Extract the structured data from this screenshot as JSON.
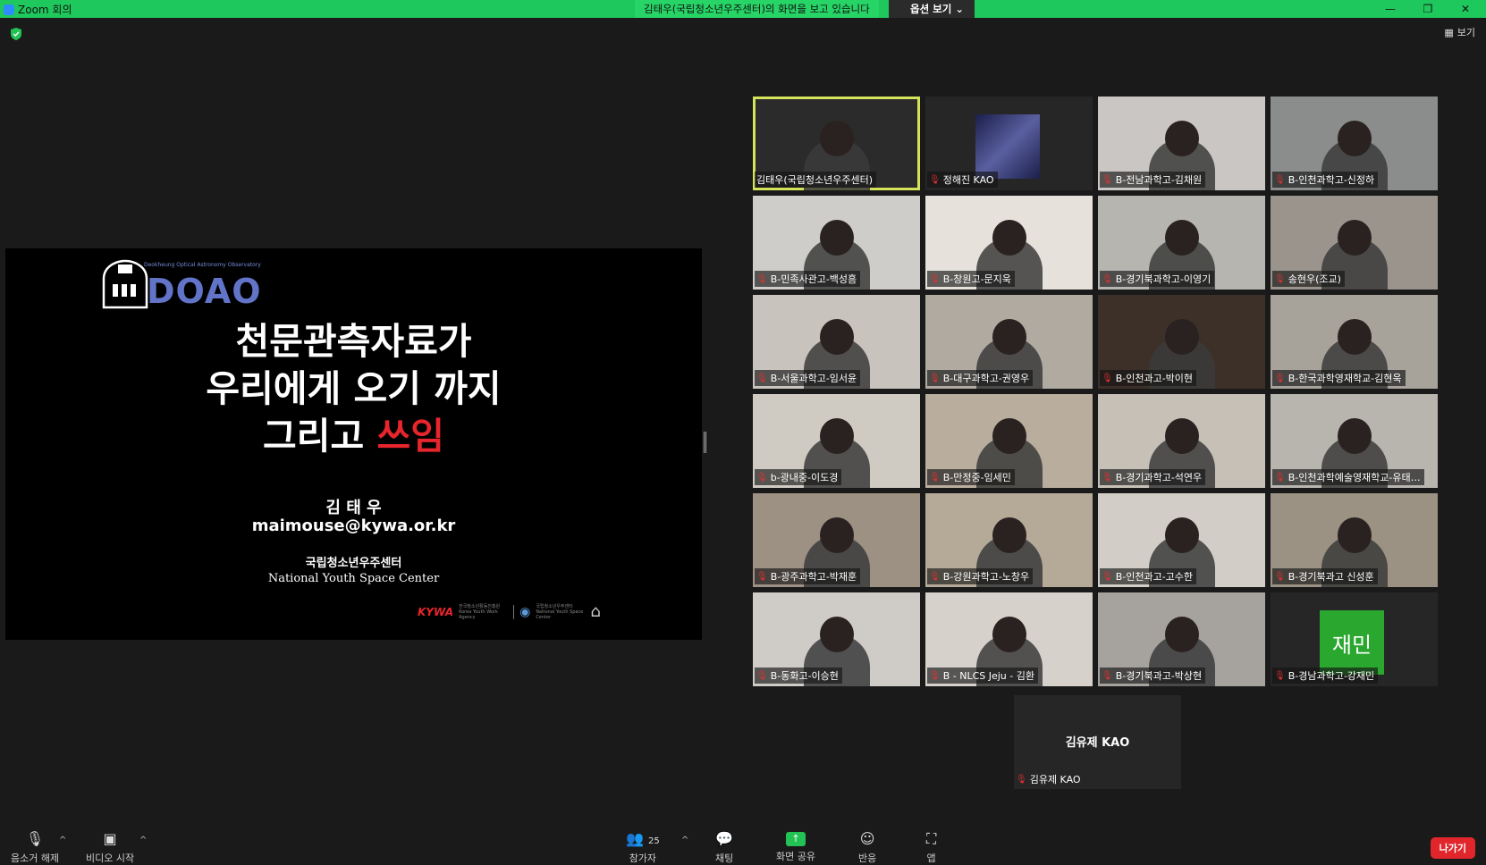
{
  "window": {
    "title": "Zoom 회의",
    "share_banner": "김태우(국립청소년우주센터)의 화면을 보고 있습니다",
    "view_options": "옵션 보기",
    "minimize": "—",
    "restore": "❐",
    "close": "✕"
  },
  "top_right": {
    "view_label": "보기"
  },
  "slide": {
    "logo_small_text": "Deokheung Optical Astronomy Observatory",
    "logo_text": "DOAO",
    "title_line1": "천문관측자료가",
    "title_line2": "우리에게 오기 까지",
    "title_line3_prefix": "그리고 ",
    "title_line3_highlight": "쓰임",
    "author": "김 태 우",
    "email": "maimouse@kywa.or.kr",
    "org_ko": "국립청소년우주센터",
    "org_en": "National Youth Space Center",
    "footer_kywa": "KYWA",
    "footer_kywa_sub": "한국청소년활동진흥원 Korea Youth Work Agency",
    "footer_center_sub": "국립청소년우주센터 National Youth Space Center"
  },
  "participants": [
    {
      "name": "김태우(국립청소년우주센터)",
      "muted": false,
      "active": true,
      "bg": "#2b2b2b"
    },
    {
      "name": "정해진 KAO",
      "muted": true,
      "active": false,
      "bg": "#262626"
    },
    {
      "name": "B-전남과학고-김채원",
      "muted": true,
      "active": false,
      "bg": "#c9c6c4"
    },
    {
      "name": "B-인천과학고-신정하",
      "muted": true,
      "active": false,
      "bg": "#8a8d8c"
    },
    {
      "name": "B-민족사관고-백성흠",
      "muted": true,
      "active": false,
      "bg": "#cfcdca"
    },
    {
      "name": "B-창원고-문지욱",
      "muted": true,
      "active": false,
      "bg": "#e6e1da"
    },
    {
      "name": "B-경기북과학고-이영기",
      "muted": true,
      "active": false,
      "bg": "#b7b5b0"
    },
    {
      "name": "송현우(조교)",
      "muted": true,
      "active": false,
      "bg": "#9a948c"
    },
    {
      "name": "B-서울과학고-임서윤",
      "muted": true,
      "active": false,
      "bg": "#c8c3bc"
    },
    {
      "name": "B-대구과학고-권영우",
      "muted": true,
      "active": false,
      "bg": "#b0aaa1"
    },
    {
      "name": "B-인천과고-박이현",
      "muted": true,
      "active": false,
      "bg": "#3d3029"
    },
    {
      "name": "B-한국과학영재학교-김현욱",
      "muted": true,
      "active": false,
      "bg": "#a7a29a"
    },
    {
      "name": "b-광내중-이도경",
      "muted": true,
      "active": false,
      "bg": "#cfcbc2"
    },
    {
      "name": "B-만정중-임세민",
      "muted": true,
      "active": false,
      "bg": "#b9ad9d"
    },
    {
      "name": "B-경기과학고-석연우",
      "muted": true,
      "active": false,
      "bg": "#c6c0b7"
    },
    {
      "name": "B-인천과학예술영재학교-유태…",
      "muted": true,
      "active": false,
      "bg": "#b8b4ae"
    },
    {
      "name": "B-광주과학고-박재훈",
      "muted": true,
      "active": false,
      "bg": "#9d9184"
    },
    {
      "name": "B-강원과학고-노창우",
      "muted": true,
      "active": false,
      "bg": "#b5aa97"
    },
    {
      "name": "B-인천과고-고수한",
      "muted": true,
      "active": false,
      "bg": "#d2cdc6"
    },
    {
      "name": "B-경기북과고 신성훈",
      "muted": true,
      "active": false,
      "bg": "#9c9283"
    },
    {
      "name": "B-동화고-이승현",
      "muted": true,
      "active": false,
      "bg": "#cfcbc6"
    },
    {
      "name": "B - NLCS Jeju - 김환",
      "muted": true,
      "active": false,
      "bg": "#d6d1ca"
    },
    {
      "name": "B-경기북과고-박상현",
      "muted": true,
      "active": false,
      "bg": "#a6a39e"
    },
    {
      "name": "B-경남과학고-강재민",
      "muted": true,
      "active": false,
      "bg": "#262626",
      "avatar": "재민"
    }
  ],
  "extra_participant": {
    "display_name": "김유제 KAO",
    "label": "김유제 KAO",
    "muted": true
  },
  "toolbar": {
    "mute_label": "음소거 해제",
    "video_label": "비디오 시작",
    "participants_label": "참가자",
    "participants_count": "25",
    "chat_label": "채팅",
    "share_label": "화면 공유",
    "reactions_label": "반응",
    "apps_label": "앱",
    "leave_label": "나가기"
  },
  "colors": {
    "titlebar": "#1ec85c",
    "active_speaker": "#d5e35a",
    "leave": "#e0262b",
    "avatar": "#2aa72e",
    "slide_accent": "#e8252d",
    "doao": "#6274c8"
  },
  "icons": {
    "shield": "shield-icon",
    "mic_off": "mic-off-icon",
    "video_off": "video-off-icon",
    "participants": "people-icon",
    "chat": "chat-bubble-icon",
    "share": "share-screen-icon",
    "reactions": "emoji-icon",
    "apps": "apps-icon",
    "grid_view": "grid-view-icon"
  }
}
